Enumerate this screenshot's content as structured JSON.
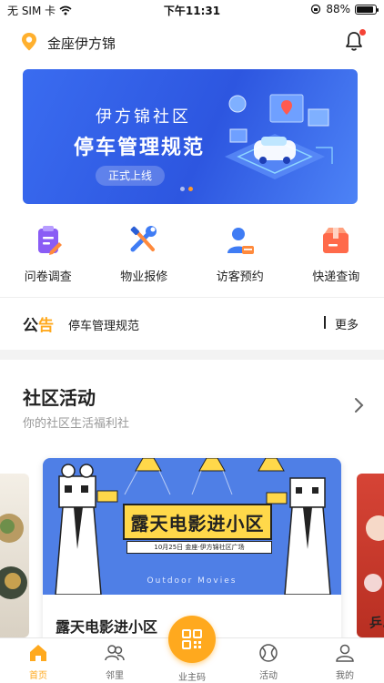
{
  "status_bar": {
    "carrier": "无 SIM 卡",
    "time": "下午11:31",
    "battery": "88%",
    "battery_level": 0.88
  },
  "header": {
    "location": "金座伊方锦"
  },
  "banner": {
    "line1": "伊方锦社区",
    "line2": "停车管理规范",
    "tag": "正式上线"
  },
  "quick_actions": [
    {
      "label": "问卷调查",
      "icon": "questionnaire-icon"
    },
    {
      "label": "物业报修",
      "icon": "repair-tools-icon"
    },
    {
      "label": "访客预约",
      "icon": "visitor-icon"
    },
    {
      "label": "快递查询",
      "icon": "package-icon"
    }
  ],
  "notice": {
    "logo_a": "公",
    "logo_b": "告",
    "text": "停车管理规范",
    "more": "更多"
  },
  "activity": {
    "title": "社区活动",
    "subtitle": "你的社区生活福利社",
    "card": {
      "poster_title": "露天电影进小区",
      "poster_date": "10月25日 金座·伊方锦社区广场",
      "poster_en": "Outdoor Movies",
      "title": "露天电影进小区"
    },
    "next_card_title": "乒..."
  },
  "tabbar": {
    "home": "首页",
    "neighbors": "邻里",
    "qr": "业主码",
    "events": "活动",
    "mine": "我的"
  },
  "colors": {
    "accent": "#ffa91e",
    "banner_blue": "#2d56e0",
    "poster_blue": "#4f7fe6"
  }
}
